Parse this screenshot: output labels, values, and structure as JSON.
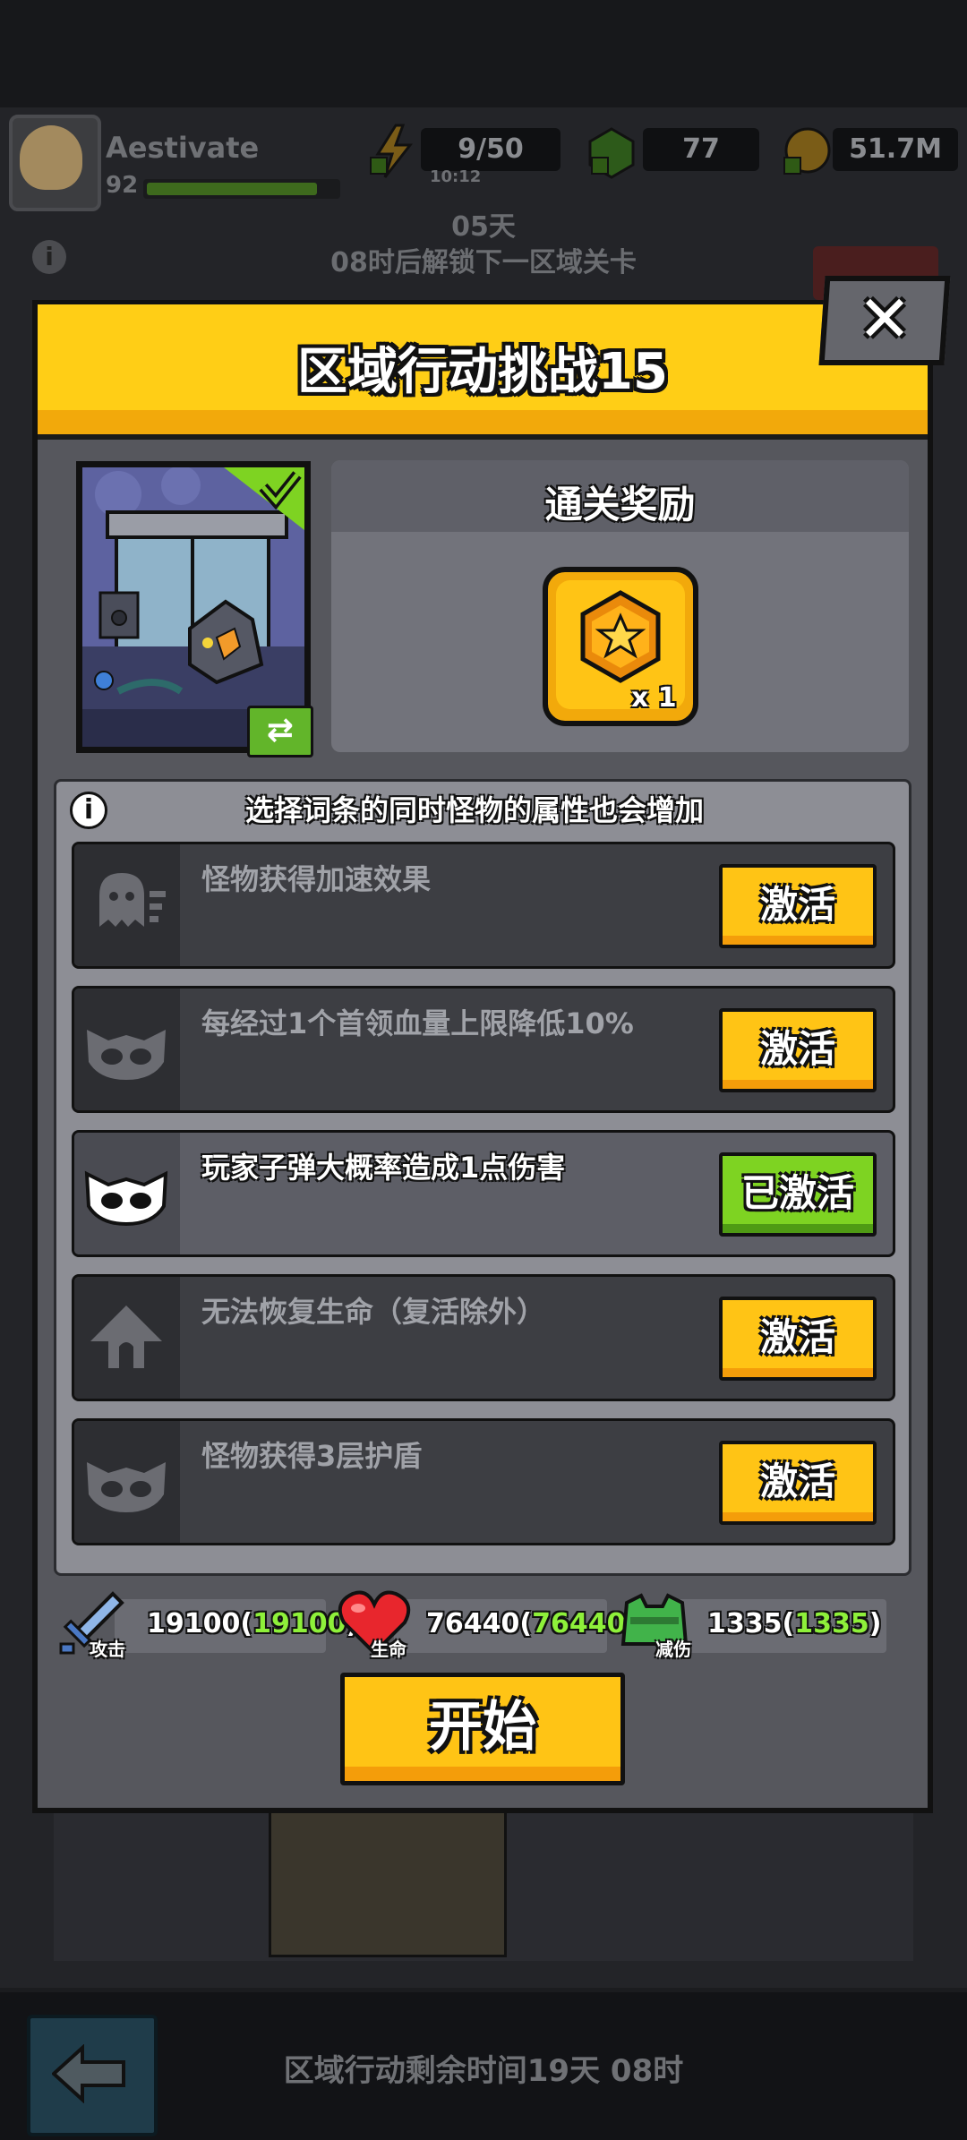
{
  "hud": {
    "player_name": "Aestivate",
    "player_level": "92",
    "energy": "9/50",
    "energy_timer": "10:12",
    "gems": "77",
    "coins": "51.7M"
  },
  "unlock": {
    "days": "05天",
    "text": "08时后解锁下一区域关卡"
  },
  "dialog": {
    "title": "区域行动挑战15",
    "reward_title": "通关奖励",
    "reward_qty": "x 1",
    "refresh_icon": "refresh-icon",
    "hint": "选择词条的同时怪物的属性也会增加",
    "modifiers": [
      {
        "label": "怪物获得加速效果",
        "button": "激活",
        "active": false,
        "icon": "speed-ghost-icon"
      },
      {
        "label": "每经过1个首领血量上限降低10%",
        "button": "激活",
        "active": false,
        "icon": "skull-mask-icon"
      },
      {
        "label": "玩家子弹大概率造成1点伤害",
        "button": "已激活",
        "active": true,
        "icon": "skull-mask-icon"
      },
      {
        "label": "无法恢复生命（复活除外）",
        "button": "激活",
        "active": false,
        "icon": "no-heal-icon"
      },
      {
        "label": "怪物获得3层护盾",
        "button": "激活",
        "active": false,
        "icon": "skull-mask-icon"
      }
    ],
    "stats": {
      "attack_label": "攻击",
      "attack_value": "19100",
      "attack_bonus": "19100",
      "hp_label": "生命",
      "hp_value": "76440",
      "hp_bonus": "76440",
      "dr_label": "减伤",
      "dr_value": "1335",
      "dr_bonus": "1335"
    },
    "start_label": "开始",
    "close_label": "✕"
  },
  "footer": {
    "remaining": "区域行动剩余时间19天 08时"
  },
  "colors": {
    "header_yellow": "#ffce16",
    "button_yellow": "#ffc415",
    "button_green": "#7ed322",
    "stat_green": "#8ef03a"
  }
}
